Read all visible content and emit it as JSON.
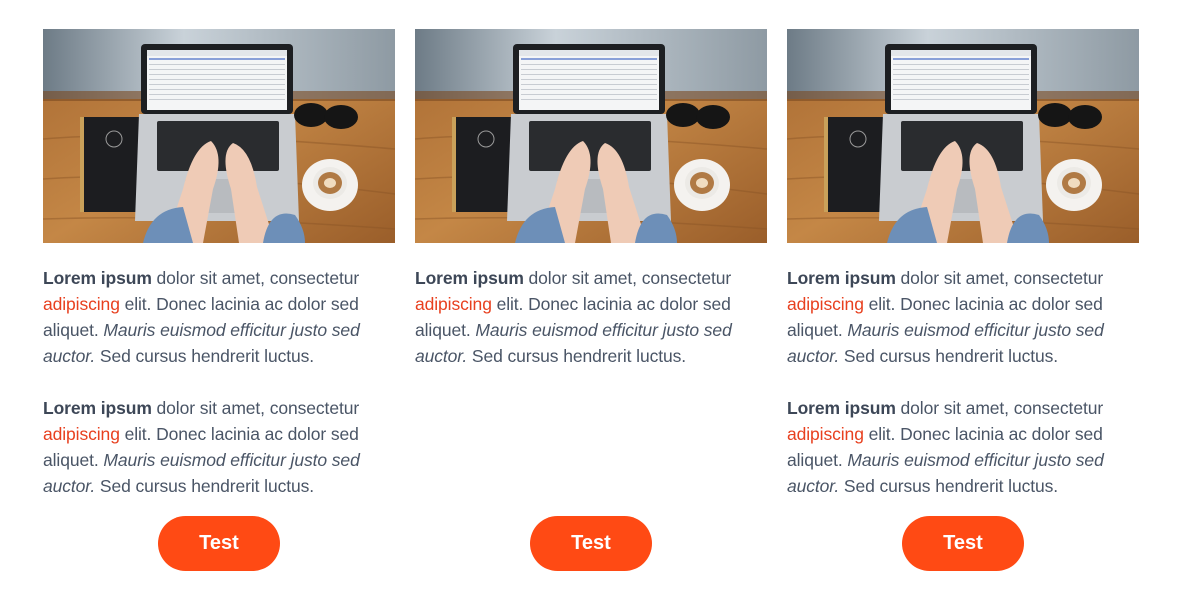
{
  "image": {
    "description": "laptop-on-wooden-desk-photo"
  },
  "cards": [
    {
      "paragraphs": [
        {
          "bold": "Lorem ipsum",
          "text1": " dolor sit amet, consectetur ",
          "link": "adipiscing",
          "text2": " elit. Donec lacinia ac dolor sed aliquet. ",
          "italic": "Mauris euismod efficitur justo sed auctor.",
          "text3": " Sed cursus hendrerit luctus."
        },
        {
          "bold": "Lorem ipsum",
          "text1": " dolor sit amet, consectetur ",
          "link": "adipiscing",
          "text2": " elit. Donec lacinia ac dolor sed aliquet. ",
          "italic": "Mauris euismod efficitur justo sed auctor.",
          "text3": " Sed cursus hendrerit luctus."
        }
      ],
      "button_label": "Test"
    },
    {
      "paragraphs": [
        {
          "bold": "Lorem ipsum",
          "text1": " dolor sit amet, consectetur ",
          "link": "adipiscing",
          "text2": " elit. Donec lacinia ac dolor sed aliquet. ",
          "italic": "Mauris euismod efficitur justo sed auctor.",
          "text3": " Sed cursus hendrerit luctus."
        }
      ],
      "button_label": "Test"
    },
    {
      "paragraphs": [
        {
          "bold": "Lorem ipsum",
          "text1": " dolor sit amet, consectetur ",
          "link": "adipiscing",
          "text2": " elit. Donec lacinia ac dolor sed aliquet. ",
          "italic": "Mauris euismod efficitur justo sed auctor.",
          "text3": " Sed cursus hendrerit luctus."
        },
        {
          "bold": "Lorem ipsum",
          "text1": " dolor sit amet, consectetur ",
          "link": "adipiscing",
          "text2": " elit. Donec lacinia ac dolor sed aliquet. ",
          "italic": "Mauris euismod efficitur justo sed auctor.",
          "text3": " Sed cursus hendrerit luctus."
        }
      ],
      "button_label": "Test"
    }
  ],
  "colors": {
    "accent": "#ff4a14",
    "link": "#e8401f",
    "text": "#4a5566"
  }
}
